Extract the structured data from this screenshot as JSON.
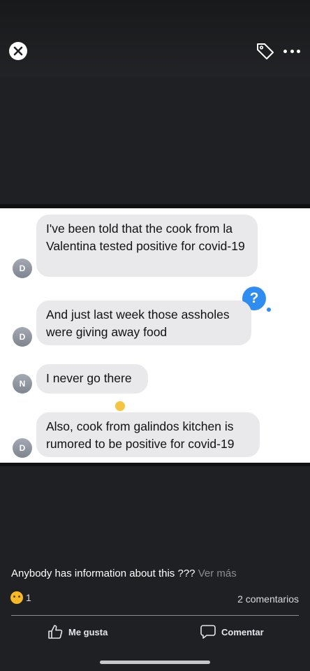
{
  "viewer": {
    "close_icon": "close-icon",
    "tag_icon": "tag-icon",
    "more_icon": "more-dots-icon"
  },
  "photo": {
    "messages": [
      {
        "avatar": "D",
        "text": "I've been told that the cook from la Valentina tested positive for covid-19"
      },
      {
        "avatar": "D",
        "text": "And just last week those assholes were giving away food"
      },
      {
        "avatar": "N",
        "text": "I never go there"
      },
      {
        "avatar": "D",
        "text": "Also, cook from galindos kitchen is rumored to be positive for covid-19"
      }
    ],
    "help_badge": "?"
  },
  "post": {
    "caption": "Anybody has information about this ???",
    "see_more": "Ver más",
    "reaction_icon": "sad-face-icon",
    "reaction_count": "1",
    "comment_count": "2 comentarios",
    "like_label": "Me gusta",
    "comment_label": "Comentar"
  },
  "colors": {
    "background": "#1f2023",
    "bubble": "#e9e9eb",
    "accent": "#2f8cf0"
  }
}
